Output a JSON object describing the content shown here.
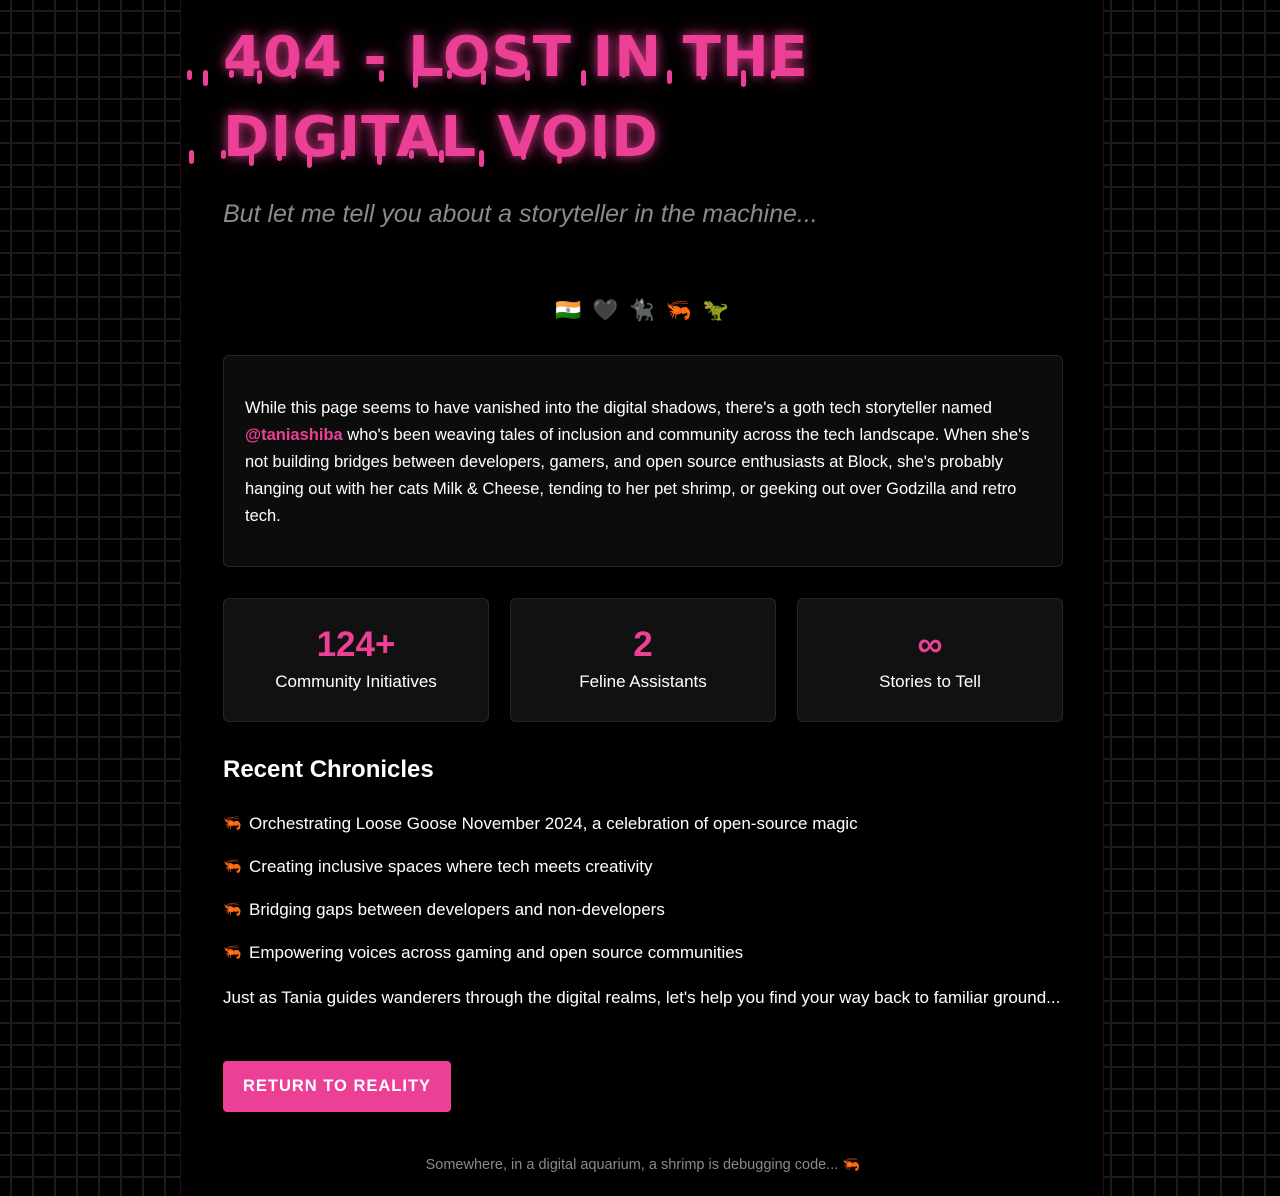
{
  "header": {
    "title_line1": "404 - LOST IN THE",
    "title_line2": "DIGITAL VOID",
    "subtitle": "But let me tell you about a storyteller in the machine..."
  },
  "emoji_row": "🇮🇳 🖤 🐈‍⬛ 🦐 🦖",
  "bio": {
    "before": "While this page seems to have vanished into the digital shadows, there's a goth tech storyteller named ",
    "mention": "@taniashiba",
    "after": " who's been weaving tales of inclusion and community across the tech landscape. When she's not building bridges between developers, gamers, and open source enthusiasts at Block, she's probably hanging out with her cats Milk & Cheese, tending to her pet shrimp, or geeking out over Godzilla and retro tech."
  },
  "stats": [
    {
      "value": "124+",
      "label": "Community Initiatives"
    },
    {
      "value": "2",
      "label": "Feline Assistants"
    },
    {
      "value": "∞",
      "label": "Stories to Tell"
    }
  ],
  "chronicles": {
    "heading": "Recent Chronicles",
    "bullet": "🦐",
    "items": [
      "Orchestrating Loose Goose November 2024, a celebration of open-source magic",
      "Creating inclusive spaces where tech meets creativity",
      "Bridging gaps between developers and non-developers",
      "Empowering voices across gaming and open source communities"
    ]
  },
  "closing": "Just as Tania guides wanderers through the digital realms, let's help you find your way back to familiar ground...",
  "button": {
    "label": "RETURN TO REALITY"
  },
  "footer": "Somewhere, in a digital aquarium, a shrimp is debugging code... 🦐",
  "colors": {
    "accent": "#ec3f96",
    "background": "#000000",
    "card": "#0c0c0c",
    "muted_text": "#8a8a8a"
  }
}
